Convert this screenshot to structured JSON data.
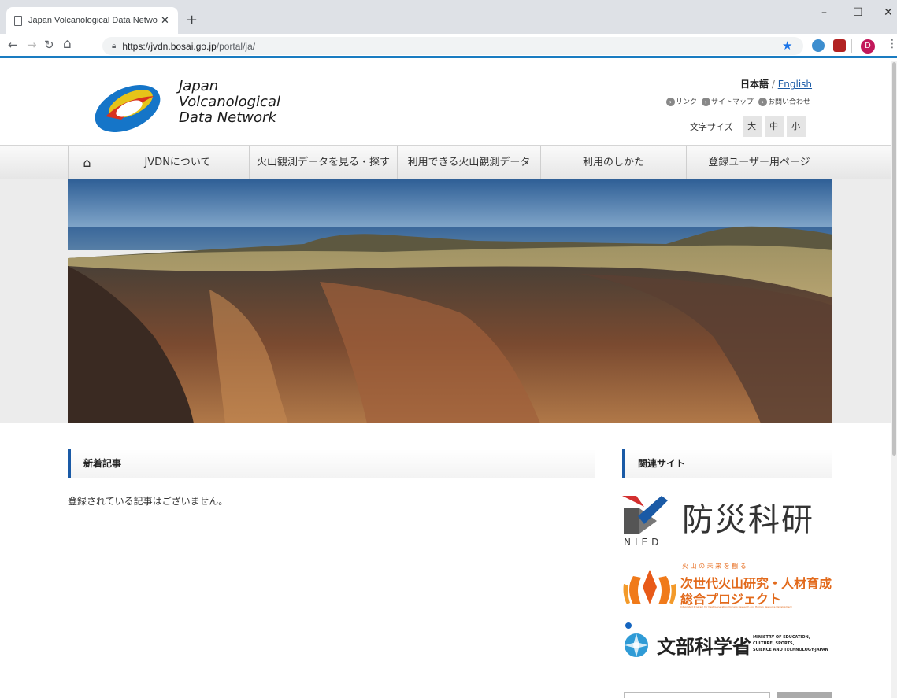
{
  "browser": {
    "tab_title": "Japan Volcanological Data Network",
    "url_host": "https://jvdn.bosai.go.jp",
    "url_path": "/portal/ja/",
    "avatar_letter": "D"
  },
  "header": {
    "logo_line1": "Japan",
    "logo_line2": "Volcanological",
    "logo_line3": "Data Network",
    "lang_ja": "日本語",
    "lang_sep": " / ",
    "lang_en": "English",
    "util_links": [
      "リンク",
      "サイトマップ",
      "お問い合わせ"
    ],
    "fontsize_label": "文字サイズ",
    "fontsize_options": [
      "大",
      "中",
      "小"
    ]
  },
  "nav": {
    "home_icon": "home-icon",
    "items": [
      "JVDNについて",
      "火山観測データを見る・探す",
      "利用できる火山観測データ",
      "利用のしかた",
      "登録ユーザー用ページ"
    ]
  },
  "news": {
    "title": "新着記事",
    "empty_message": "登録されている記事はございません。"
  },
  "related": {
    "title": "関連サイト",
    "nied_text": "防災科研",
    "nied_sub": "NIED",
    "project_tagline": "火 山 の 未 来 を 観 る",
    "project_line1": "次世代火山研究・人材育成",
    "project_line2": "総合プロジェクト",
    "project_en": "Integrated Program for Next Generation Volcano Research and Human Resource Development",
    "mext_text": "文部科学省",
    "mext_en1": "MINISTRY OF EDUCATION,",
    "mext_en2": "CULTURE, SPORTS,",
    "mext_en3": "SCIENCE AND TECHNOLOGY-JAPAN"
  },
  "colors": {
    "accent": "#1a5aa6",
    "browser_accent": "#1a7cc1"
  }
}
